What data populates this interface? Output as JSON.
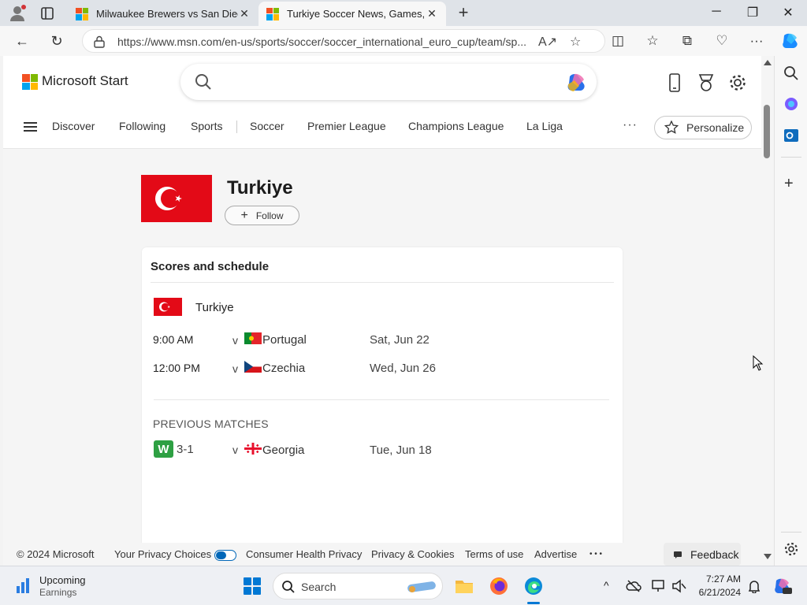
{
  "colors": {
    "turkiye_red": "#e30a17",
    "win_green": "#2ea043",
    "accent": "#0078d4"
  },
  "browser": {
    "tabs": [
      {
        "title": "Milwaukee Brewers vs San Diego",
        "active": false
      },
      {
        "title": "Turkiye Soccer News, Games, Sc",
        "active": true
      }
    ],
    "url": "https://www.msn.com/en-us/sports/soccer/soccer_international_euro_cup/team/sp..."
  },
  "header": {
    "brand": "Microsoft Start",
    "nav": [
      "Discover",
      "Following",
      "Sports",
      "Soccer",
      "Premier League",
      "Champions League",
      "La Liga"
    ],
    "more": "···",
    "personalize": "Personalize"
  },
  "team": {
    "name": "Turkiye",
    "follow_label": "Follow",
    "follow_icon": "+"
  },
  "schedule": {
    "title": "Scores and schedule",
    "team_name": "Turkiye",
    "upcoming": [
      {
        "time": "9:00 AM",
        "vs": "v",
        "opponent": "Portugal",
        "date": "Sat, Jun 22"
      },
      {
        "time": "12:00 PM",
        "vs": "v",
        "opponent": "Czechia",
        "date": "Wed, Jun 26"
      }
    ],
    "previous_label": "PREVIOUS MATCHES",
    "previous": [
      {
        "result": "W",
        "score": "3-1",
        "vs": "v",
        "opponent": "Georgia",
        "date": "Tue, Jun 18"
      }
    ]
  },
  "footer": {
    "copyright": "© 2024 Microsoft",
    "links": [
      "Your Privacy Choices",
      "Consumer Health Privacy",
      "Privacy & Cookies",
      "Terms of use",
      "Advertise"
    ],
    "more": "• • •",
    "feedback": "Feedback"
  },
  "taskbar": {
    "widget_title": "Upcoming",
    "widget_sub": "Earnings",
    "search_placeholder": "Search",
    "time": "7:27 AM",
    "date": "6/21/2024"
  }
}
